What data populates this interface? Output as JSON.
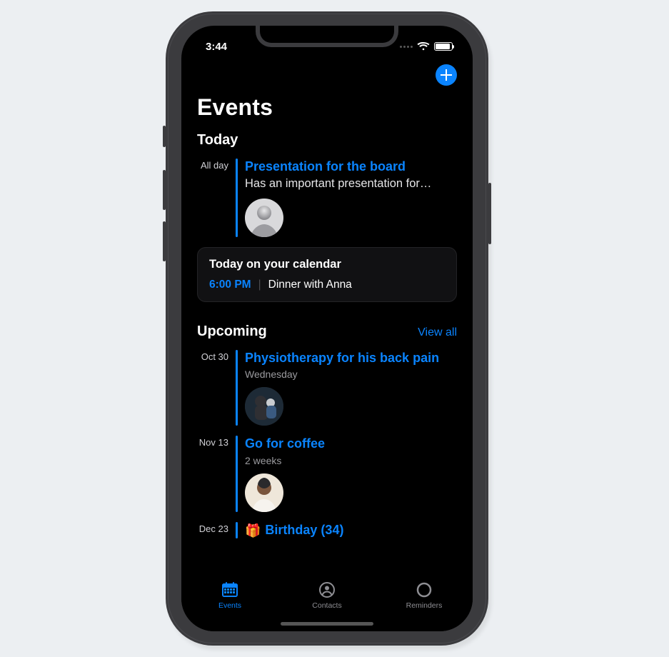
{
  "status": {
    "time": "3:44"
  },
  "nav": {
    "add_label": "Add"
  },
  "title": "Events",
  "sections": {
    "today": {
      "heading": "Today"
    },
    "upcoming": {
      "heading": "Upcoming",
      "view_all": "View all"
    }
  },
  "today_events": [
    {
      "when": "All day",
      "title": "Presentation for the board",
      "subtitle": "Has an important presentation for…"
    }
  ],
  "calendar_card": {
    "heading": "Today on your calendar",
    "items": [
      {
        "time": "6:00 PM",
        "label": "Dinner with Anna"
      }
    ]
  },
  "upcoming_events": [
    {
      "when": "Oct 30",
      "title": "Physiotherapy for his back pain",
      "meta": "Wednesday"
    },
    {
      "when": "Nov 13",
      "title": "Go for coffee",
      "meta": "2 weeks"
    },
    {
      "when": "Dec 23",
      "title": "Birthday (34)",
      "icon": "🎁"
    }
  ],
  "tabs": [
    {
      "label": "Events",
      "active": true
    },
    {
      "label": "Contacts",
      "active": false
    },
    {
      "label": "Reminders",
      "active": false
    }
  ],
  "colors": {
    "accent": "#0a84ff"
  }
}
